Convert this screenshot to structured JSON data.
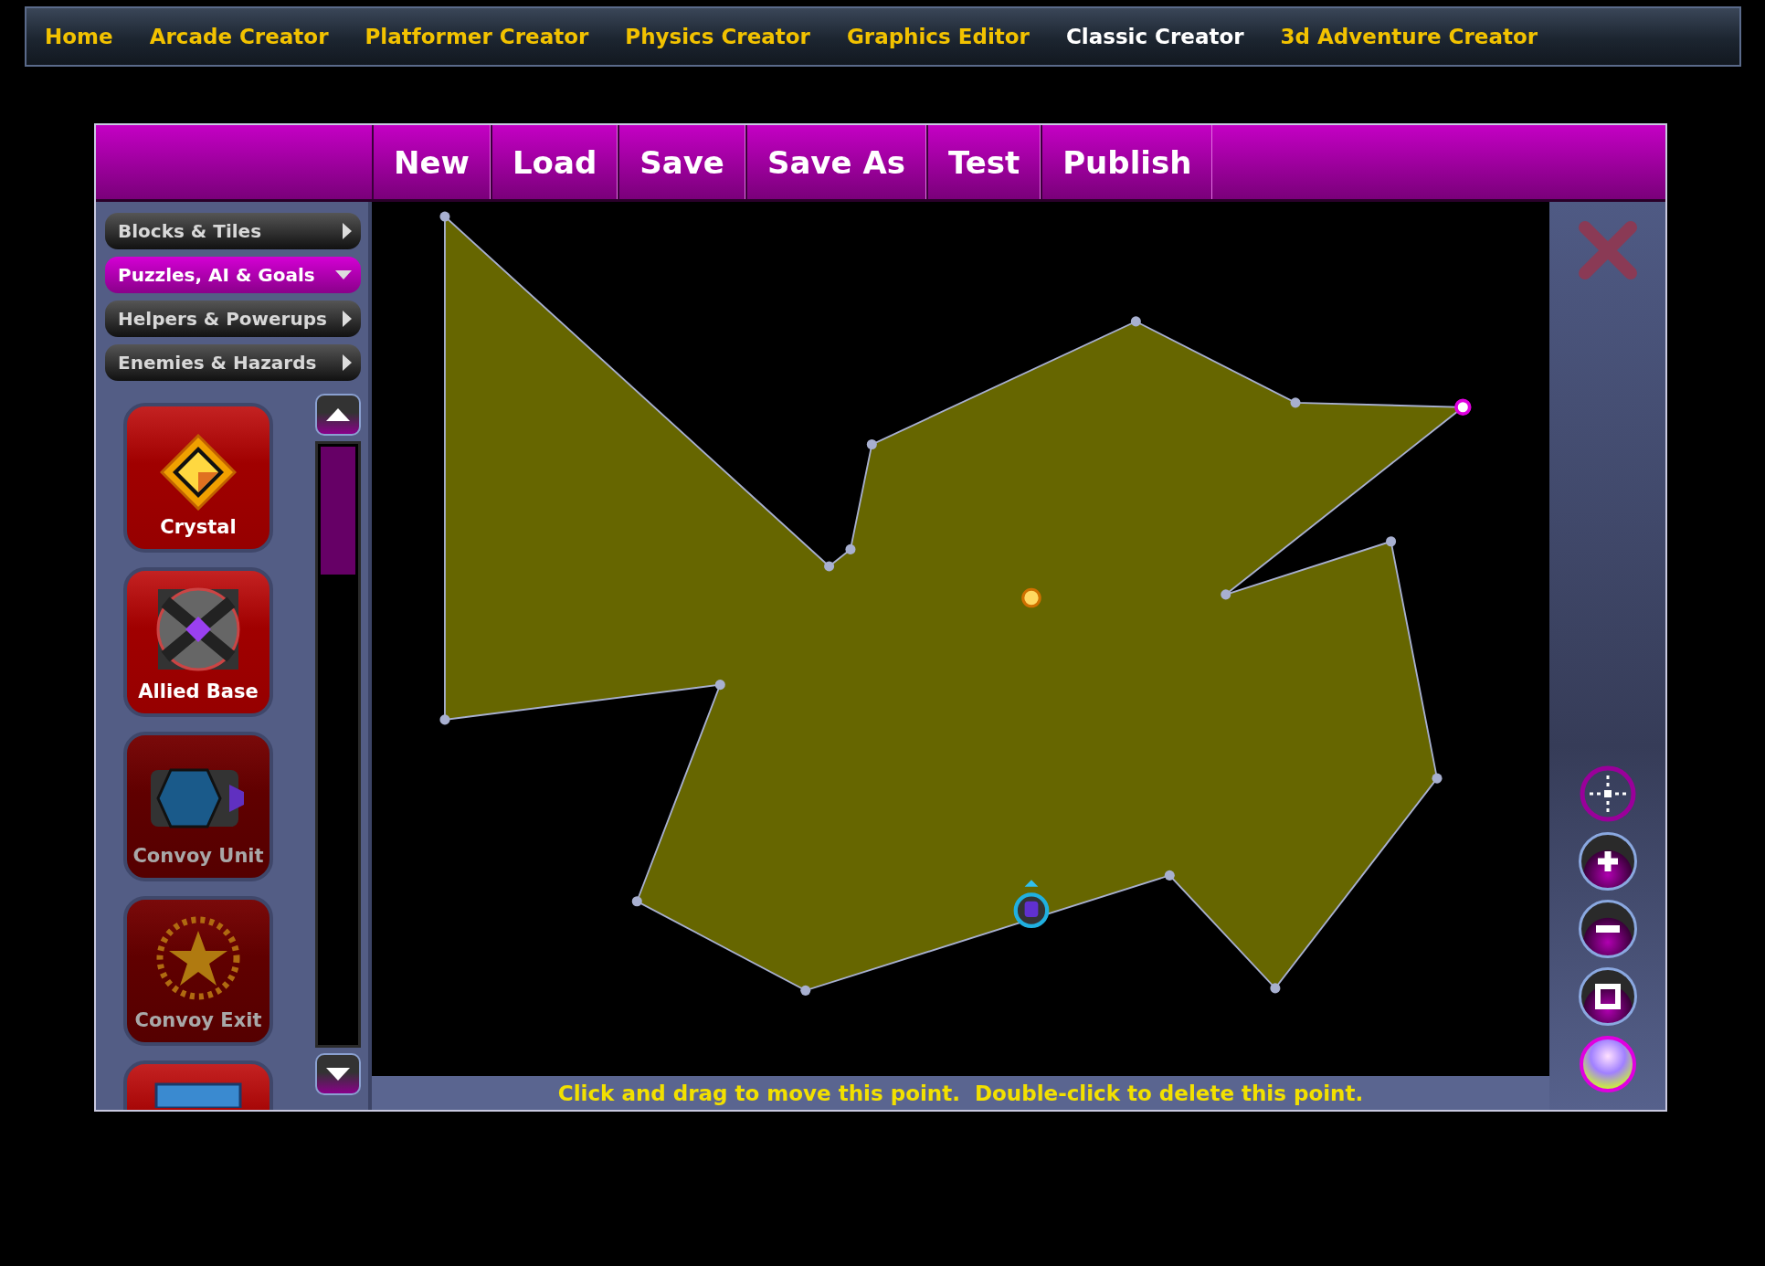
{
  "nav": [
    {
      "label": "Home",
      "selected": false
    },
    {
      "label": "Arcade Creator",
      "selected": false
    },
    {
      "label": "Platformer Creator",
      "selected": false
    },
    {
      "label": "Physics Creator",
      "selected": false
    },
    {
      "label": "Graphics Editor",
      "selected": false
    },
    {
      "label": "Classic Creator",
      "selected": true
    },
    {
      "label": "3d Adventure Creator",
      "selected": false
    }
  ],
  "toolbar": [
    "New",
    "Load",
    "Save",
    "Save As",
    "Test",
    "Publish"
  ],
  "categories": [
    {
      "label": "Blocks & Tiles",
      "expanded": false
    },
    {
      "label": "Puzzles, AI & Goals",
      "expanded": true
    },
    {
      "label": "Helpers & Powerups",
      "expanded": false
    },
    {
      "label": "Enemies & Hazards",
      "expanded": false
    }
  ],
  "palette": [
    {
      "kind": "crystal",
      "label": "Crystal",
      "disabled": false
    },
    {
      "kind": "base",
      "label": "Allied Base",
      "disabled": false
    },
    {
      "kind": "vehicle",
      "label": "Convoy Unit",
      "disabled": true
    },
    {
      "kind": "star",
      "label": "Convoy Exit",
      "disabled": true
    },
    {
      "kind": "panel",
      "disabled": false
    }
  ],
  "status_text": "Click and drag to move this point.  Double-click to delete this point."
}
